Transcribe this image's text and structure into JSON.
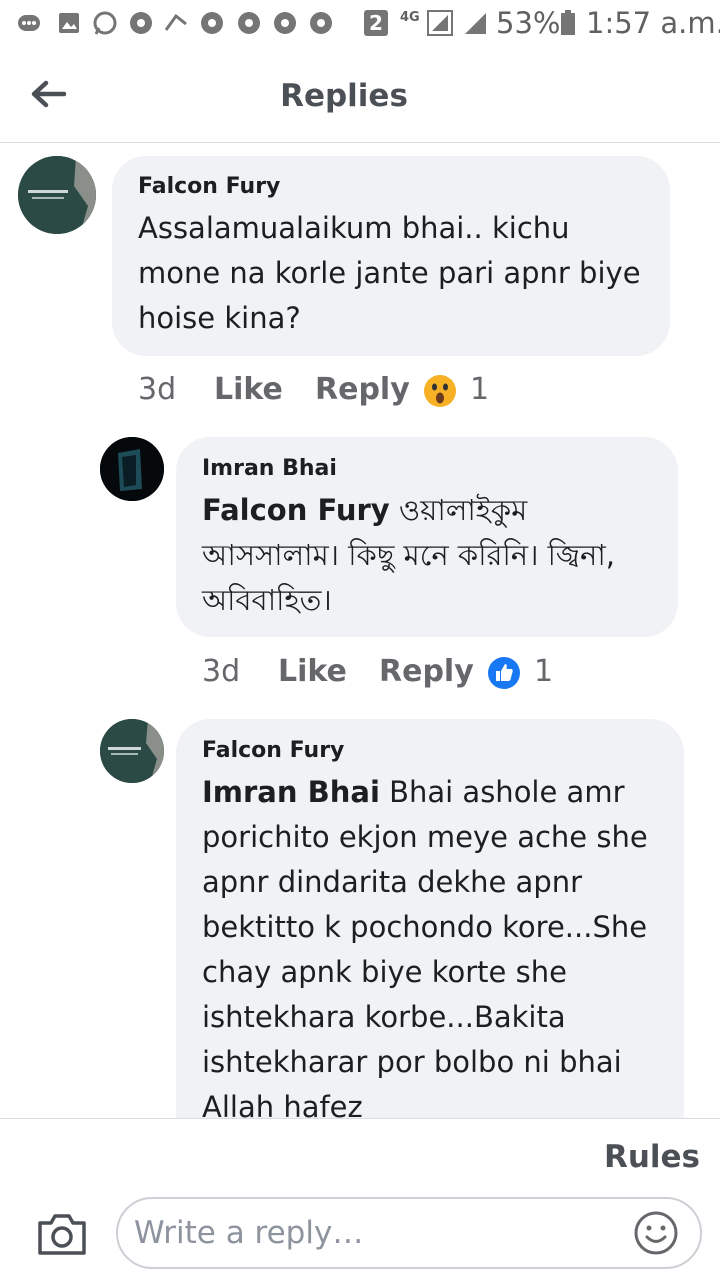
{
  "status_bar": {
    "notification_badge": "2",
    "network": "4G",
    "battery_percent": "53%",
    "time": "1:57 a.m."
  },
  "header": {
    "back_icon": "back-arrow-icon",
    "title": "Replies"
  },
  "comments": [
    {
      "author": "Falcon Fury",
      "text": "Assalamualaikum bhai.. kichu mone na korle jante pari apnr biye hoise kina?",
      "time": "3d",
      "like_label": "Like",
      "reply_label": "Reply",
      "reaction_icon": "wow-reaction-icon",
      "reaction_count": "1"
    },
    {
      "author": "Imran Bhai",
      "mention": "Falcon Fury",
      "text": "ওয়ালাইকুম আসসালাম। কিছু মনে করিনি। জ্বিনা, অবিবাহিত।",
      "time": "3d",
      "like_label": "Like",
      "reply_label": "Reply",
      "reaction_icon": "like-reaction-icon",
      "reaction_count": "1"
    },
    {
      "author": "Falcon Fury",
      "mention": "Imran Bhai",
      "text": "Bhai ashole amr porichito ekjon meye ache she apnr dindarita dekhe apnr bektitto k pochondo kore...She chay apnk biye korte she ishtekhara korbe...Bakita ishtekharar por bolbo ni bhai Allah hafez"
    }
  ],
  "footer": {
    "rules_label": "Rules",
    "camera_icon": "camera-icon",
    "reply_placeholder": "Write a reply…",
    "emoji_icon": "emoji-icon"
  },
  "colors": {
    "bubble": "#f0f2f5",
    "text": "#1c1e21",
    "meta": "#65676b",
    "like_blue": "#1877f2"
  }
}
